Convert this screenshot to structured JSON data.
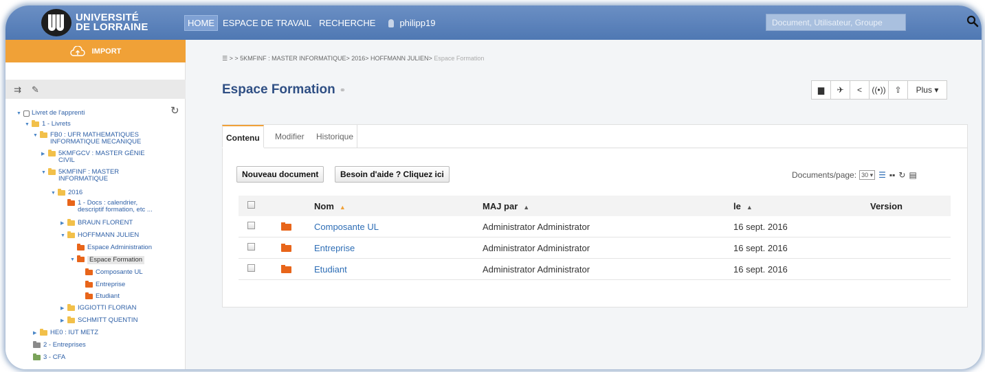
{
  "header": {
    "logo_line1": "UNIVERSITÉ",
    "logo_line2": "DE LORRAINE",
    "nav": [
      "HOME",
      "ESPACE DE TRAVAIL",
      "RECHERCHE"
    ],
    "username": "philipp19",
    "search_placeholder": "Document, Utilisateur, Groupe"
  },
  "sidebar": {
    "import_label": "IMPORT",
    "tree": {
      "root": "Livret de l'apprenti",
      "livrets": "1 - Livrets",
      "fb0": [
        "FB0 : UFR MATHEMATIQUES",
        "INFORMATIQUE MECANIQUE"
      ],
      "genie": [
        "5KMFGCV : MASTER GÉNIE",
        "CIVIL"
      ],
      "info": [
        "5KMFINF : MASTER",
        "INFORMATIQUE"
      ],
      "year": "2016",
      "docs": [
        "1 - Docs : calendrier,",
        "descriptif formation, etc ..."
      ],
      "braun": "BRAUN FLORENT",
      "hoffmann": "HOFFMANN JULIEN",
      "admin": "Espace Administration",
      "formation": "Espace Formation",
      "composante": "Composante UL",
      "entreprise": "Entreprise",
      "etudiant": "Etudiant",
      "iggiotti": "IGGIOTTI FLORIAN",
      "schmitt": "SCHMITT QUENTIN",
      "he0": "HE0 : IUT METZ",
      "entreprises": "2 - Entreprises",
      "cfa": "3 - CFA"
    }
  },
  "breadcrumb": {
    "sep": "> >",
    "items": [
      "5KMFINF : MASTER INFORMATIQUE",
      "2016",
      "HOFFMANN JULIEN"
    ],
    "current": "Espace Formation"
  },
  "page": {
    "title": "Espace Formation",
    "plus_label": "Plus"
  },
  "tabs": [
    "Contenu",
    "Modifier",
    "Historique"
  ],
  "toolbar": {
    "new_doc": "Nouveau document",
    "help": "Besoin d'aide ? Cliquez ici",
    "perpage_label": "Documents/page:",
    "perpage_value": "30"
  },
  "table": {
    "headers": {
      "name": "Nom",
      "by": "MAJ par",
      "date": "le",
      "version": "Version"
    },
    "rows": [
      {
        "name": "Composante UL",
        "by": "Administrator Administrator",
        "date": "16 sept. 2016",
        "version": ""
      },
      {
        "name": "Entreprise",
        "by": "Administrator Administrator",
        "date": "16 sept. 2016",
        "version": ""
      },
      {
        "name": "Etudiant",
        "by": "Administrator Administrator",
        "date": "16 sept. 2016",
        "version": ""
      }
    ]
  },
  "colors": {
    "header": "#5a7fb8",
    "accent": "#f0a137",
    "folder": "#e8651a",
    "title": "#2f4f84"
  }
}
